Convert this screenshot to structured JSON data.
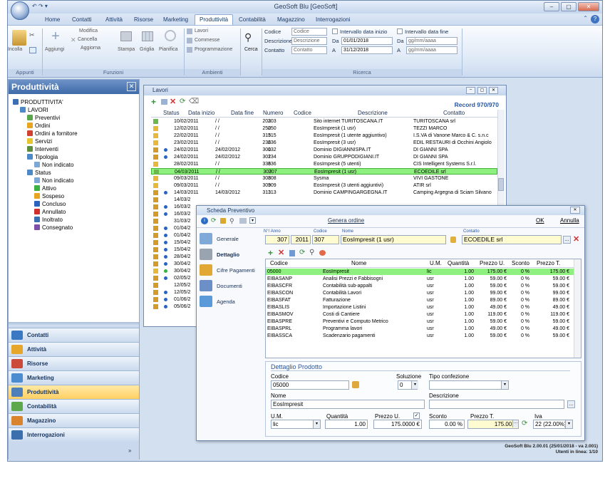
{
  "app": {
    "title": "GeoSoft Blu [GeoSoft]",
    "version_line1": "GeoSoft Blu 2.00.01 (25/01/2018 - va 2.001)",
    "version_line2": "Utenti in linea: 1/10"
  },
  "ribbon_tabs": [
    "Home",
    "Contatti",
    "Attività",
    "Risorse",
    "Marketing",
    "Produttività",
    "Contabilità",
    "Magazzino",
    "Interrogazioni"
  ],
  "ribbon": {
    "appunti": {
      "label": "Appunti",
      "incolla": "Incolla"
    },
    "funzioni": {
      "label": "Funzioni",
      "aggiungi": "Aggiungi",
      "modifica": "Modifica",
      "cancella": "Cancella",
      "aggiorna": "Aggiorna",
      "stampa": "Stampa",
      "griglia": "Griglia",
      "pianifica": "Pianifica"
    },
    "ambienti": {
      "label": "Ambienti",
      "lavori": "Lavori",
      "commesse": "Commesse",
      "programmazione": "Programmazione"
    },
    "cerca": "Cerca",
    "ricerca": {
      "label": "Ricerca",
      "codice_label": "Codice",
      "codice_ph": "Codice",
      "descrizione_label": "Descrizione",
      "descrizione_ph": "Descrizione",
      "contatto_label": "Contatto",
      "contatto_ph": "Contatto",
      "intervallo_inizio": "Intervallo data inizio",
      "intervallo_fine": "Intervallo data fine",
      "da": "Da",
      "a": "A",
      "da_inizio": "01/01/2018",
      "a_inizio": "31/12/2018",
      "da_fine": "gg/mm/aaaa",
      "a_fine": "gg/mm/aaaa"
    }
  },
  "left_panel": {
    "title": "Produttività",
    "tree": [
      {
        "label": "PRODUTTIVITA'",
        "level": 0,
        "color": "#3b6fb3"
      },
      {
        "label": "LAVORI",
        "level": 1,
        "color": "#4d88c9"
      },
      {
        "label": "Preventivi",
        "level": 2,
        "color": "#58a84b"
      },
      {
        "label": "Ordini",
        "level": 2,
        "color": "#e7a521"
      },
      {
        "label": "Ordini a fornitore",
        "level": 2,
        "color": "#d0412f"
      },
      {
        "label": "Servizi",
        "level": 2,
        "color": "#e7c531"
      },
      {
        "label": "Interventi",
        "level": 2,
        "color": "#5b8f3d"
      },
      {
        "label": "Tipologia",
        "level": 2,
        "color": "#4d88c9"
      },
      {
        "label": "Non indicato",
        "level": 3,
        "color": "#7fa7d6"
      },
      {
        "label": "Status",
        "level": 2,
        "color": "#4d88c9"
      },
      {
        "label": "Non indicato",
        "level": 3,
        "color": "#7fa7d6"
      },
      {
        "label": "Attivo",
        "level": 3,
        "color": "#3cb043"
      },
      {
        "label": "Sospeso",
        "level": 3,
        "color": "#e7a521"
      },
      {
        "label": "Concluso",
        "level": 3,
        "color": "#2c63c1"
      },
      {
        "label": "Annullato",
        "level": 3,
        "color": "#d0312f"
      },
      {
        "label": "Inoltrato",
        "level": 3,
        "color": "#3b6fb3"
      },
      {
        "label": "Consegnato",
        "level": 3,
        "color": "#7d4fa8"
      }
    ],
    "nav": [
      {
        "label": "Contatti",
        "color": "#3b78c4"
      },
      {
        "label": "Attività",
        "color": "#e6a52b"
      },
      {
        "label": "Risorse",
        "color": "#cc4a3a"
      },
      {
        "label": "Marketing",
        "color": "#4b8bd0"
      },
      {
        "label": "Produttività",
        "color": "#4f7fb8"
      },
      {
        "label": "Contabilità",
        "color": "#5da84a"
      },
      {
        "label": "Magazzino",
        "color": "#d9842c"
      },
      {
        "label": "Interrogazioni",
        "color": "#3c6fae"
      }
    ],
    "active_nav": "Produttività"
  },
  "lavori": {
    "title": "Lavori",
    "record": "Record 970/970",
    "columns": [
      "Status",
      "Data inizio",
      "Data fine",
      "Numero",
      "Codice",
      "Descrizione",
      "Contatto"
    ],
    "rows": [
      {
        "dot": "",
        "date": "10/02/2011",
        "end": "/ /",
        "num": "203",
        "cod": "203",
        "desc": "Sito internet TURITOSCANA.IT",
        "cont": "TURITOSCANA srl",
        "st": "g"
      },
      {
        "dot": "",
        "date": "12/02/2011",
        "end": "/ /",
        "num": "250",
        "cod": "250",
        "desc": "EosImpresit (1 usr)",
        "cont": "TEZZI MARCO",
        "st": "y"
      },
      {
        "dot": "",
        "date": "22/02/2011",
        "end": "/ /",
        "num": "315",
        "cod": "315",
        "desc": "EosImpresit (1 utente aggiuntivo)",
        "cont": "I.S.VA di Vanone Marco & C. s.n.c",
        "st": "y"
      },
      {
        "dot": "",
        "date": "23/02/2011",
        "end": "/ /",
        "num": "236",
        "cod": "236",
        "desc": "EosImpresit (3 usr)",
        "cont": "EDIL RESTAURI di Occhini Angiolo",
        "st": "y"
      },
      {
        "dot": "b",
        "date": "24/02/2011",
        "end": "24/02/2012",
        "num": "300",
        "cod": "132",
        "desc": "Dominio DIGIANNISPA.IT",
        "cont": "DI GIANNI SPA",
        "st": "o"
      },
      {
        "dot": "b",
        "date": "24/02/2011",
        "end": "24/02/2012",
        "num": "302",
        "cod": "134",
        "desc": "Dominio GRUPPODIGIANI.IT",
        "cont": "DI GIANNI SPA",
        "st": "o"
      },
      {
        "dot": "",
        "date": "28/02/2011",
        "end": "/ /",
        "num": "336",
        "cod": "336",
        "desc": "EosImpresit (5 utenti)",
        "cont": "CIS Intelligent Systems S.r.l.",
        "st": "y"
      },
      {
        "dot": "",
        "date": "04/03/2011",
        "end": "/ /",
        "num": "307",
        "cod": "307",
        "desc": "EosImpresit (1 usr)",
        "cont": "ECOEDILE srl",
        "st": "g",
        "sel": true
      },
      {
        "dot": "",
        "date": "09/03/2011",
        "end": "/ /",
        "num": "308",
        "cod": "308",
        "desc": "Sysma",
        "cont": "VIVI GASTONE",
        "st": "y"
      },
      {
        "dot": "",
        "date": "09/03/2011",
        "end": "/ /",
        "num": "309",
        "cod": "309",
        "desc": "EosImpresit (3 utenti aggiuntivi)",
        "cont": "ATIR srl",
        "st": "y"
      },
      {
        "dot": "b",
        "date": "14/03/2011",
        "end": "14/03/2012",
        "num": "313",
        "cod": "313",
        "desc": "Dominio CAMPINGARGEGNA.IT",
        "cont": "Camping Argegna di Sciam Silvano",
        "st": "o"
      },
      {
        "dot": "",
        "date": "14/03/2",
        "end": "",
        "num": "",
        "cod": "",
        "desc": "",
        "cont": "",
        "st": "o"
      },
      {
        "dot": "b",
        "date": "16/03/2",
        "end": "",
        "num": "",
        "cod": "",
        "desc": "",
        "cont": "",
        "st": "o"
      },
      {
        "dot": "b",
        "date": "16/03/2",
        "end": "",
        "num": "",
        "cod": "",
        "desc": "",
        "cont": "",
        "st": "o"
      },
      {
        "dot": "",
        "date": "31/03/2",
        "end": "",
        "num": "",
        "cod": "",
        "desc": "",
        "cont": "",
        "st": "o"
      },
      {
        "dot": "b",
        "date": "01/04/2",
        "end": "",
        "num": "",
        "cod": "",
        "desc": "",
        "cont": "",
        "st": "o"
      },
      {
        "dot": "b",
        "date": "01/04/2",
        "end": "",
        "num": "",
        "cod": "",
        "desc": "",
        "cont": "",
        "st": "o"
      },
      {
        "dot": "b",
        "date": "15/04/2",
        "end": "",
        "num": "",
        "cod": "",
        "desc": "",
        "cont": "",
        "st": "o"
      },
      {
        "dot": "b",
        "date": "15/04/2",
        "end": "",
        "num": "",
        "cod": "",
        "desc": "",
        "cont": "",
        "st": "o"
      },
      {
        "dot": "b",
        "date": "28/04/2",
        "end": "",
        "num": "",
        "cod": "",
        "desc": "",
        "cont": "",
        "st": "o"
      },
      {
        "dot": "b",
        "date": "30/04/2",
        "end": "",
        "num": "",
        "cod": "",
        "desc": "",
        "cont": "",
        "st": "o"
      },
      {
        "dot": "g",
        "date": "30/04/2",
        "end": "",
        "num": "",
        "cod": "",
        "desc": "",
        "cont": "",
        "st": "y"
      },
      {
        "dot": "b",
        "date": "02/05/2",
        "end": "",
        "num": "",
        "cod": "",
        "desc": "",
        "cont": "",
        "st": "o"
      },
      {
        "dot": "",
        "date": "12/05/2",
        "end": "",
        "num": "",
        "cod": "",
        "desc": "",
        "cont": "",
        "st": "o"
      },
      {
        "dot": "b",
        "date": "12/05/2",
        "end": "",
        "num": "",
        "cod": "",
        "desc": "",
        "cont": "",
        "st": "o"
      },
      {
        "dot": "b",
        "date": "01/06/2",
        "end": "",
        "num": "",
        "cod": "",
        "desc": "",
        "cont": "",
        "st": "o"
      },
      {
        "dot": "b",
        "date": "05/06/2",
        "end": "",
        "num": "",
        "cod": "",
        "desc": "",
        "cont": "",
        "st": "o"
      }
    ]
  },
  "scheda": {
    "title": "Scheda Preventivo",
    "genera": "Genera ordine",
    "ok": "OK",
    "annulla": "Annulla",
    "nav": [
      "Generale",
      "Dettaglio",
      "Cifre Pagamenti",
      "Documenti",
      "Agenda"
    ],
    "active_nav": "Dettaglio",
    "hdr_labels": {
      "anno": "N°/ Anno",
      "codice": "Codice",
      "nome": "Nome",
      "contatto": "Contatto"
    },
    "hdr_values": {
      "num": "307",
      "anno": "2011",
      "codice": "307",
      "nome": "EosImpresit (1 usr)",
      "contatto": "ECOEDILE srl"
    },
    "grid_columns": [
      "Codice",
      "Nome",
      "U.M.",
      "Quantità",
      "Prezzo U.",
      "Sconto",
      "Prezzo T."
    ],
    "grid_rows": [
      {
        "cod": "05000",
        "nome": "EosImpresit",
        "um": "lic",
        "q": "1.00",
        "pu": "175.00 €",
        "sc": "0 %",
        "pt": "175.00 €",
        "sel": true
      },
      {
        "cod": "EIBASANP",
        "nome": "Analisi Prezzi e Fabbisogni",
        "um": "usr",
        "q": "1.00",
        "pu": "59.00 €",
        "sc": "0 %",
        "pt": "59.00 €"
      },
      {
        "cod": "EIBASCFR",
        "nome": "Contabilità sub-appalti",
        "um": "usr",
        "q": "1.00",
        "pu": "59.00 €",
        "sc": "0 %",
        "pt": "59.00 €"
      },
      {
        "cod": "EIBASCON",
        "nome": "Contabilità Lavori",
        "um": "usr",
        "q": "1.00",
        "pu": "99.00 €",
        "sc": "0 %",
        "pt": "99.00 €"
      },
      {
        "cod": "EIBASFAT",
        "nome": "Fatturazione",
        "um": "usr",
        "q": "1.00",
        "pu": "89.00 €",
        "sc": "0 %",
        "pt": "89.00 €"
      },
      {
        "cod": "EIBASLIS",
        "nome": "Importazione Listini",
        "um": "usr",
        "q": "1.00",
        "pu": "49.00 €",
        "sc": "0 %",
        "pt": "49.00 €"
      },
      {
        "cod": "EIBASMOV",
        "nome": "Costi di Cantiere",
        "um": "usr",
        "q": "1.00",
        "pu": "119.00 €",
        "sc": "0 %",
        "pt": "119.00 €"
      },
      {
        "cod": "EIBASPRE",
        "nome": "Preventivi e Computo Metrico",
        "um": "usr",
        "q": "1.00",
        "pu": "59.00 €",
        "sc": "0 %",
        "pt": "59.00 €"
      },
      {
        "cod": "EIBASPRL",
        "nome": "Programma lavori",
        "um": "usr",
        "q": "1.00",
        "pu": "49.00 €",
        "sc": "0 %",
        "pt": "49.00 €"
      },
      {
        "cod": "EIBASSCA",
        "nome": "Scadenzario pagamenti",
        "um": "usr",
        "q": "1.00",
        "pu": "59.00 €",
        "sc": "0 %",
        "pt": "59.00 €"
      }
    ],
    "detail": {
      "title": "Dettaglio Prodotto",
      "codice_label": "Codice",
      "codice": "05000",
      "soluzione_label": "Soluzione",
      "soluzione": "0",
      "tipo_label": "Tipo confezione",
      "tipo": "",
      "nome_label": "Nome",
      "nome": "EosImpresit",
      "descrizione_label": "Descrizione",
      "descrizione": "",
      "um_label": "U.M.",
      "um": "lic",
      "quantita_label": "Quantità",
      "quantita": "1.00",
      "prezzou_label": "Prezzo U.",
      "prezzou": "175.0000 €",
      "sconto_label": "Sconto",
      "sconto": "0.00 %",
      "prezzot_label": "Prezzo T.",
      "prezzot": "175.00 €",
      "iva_label": "Iva",
      "iva": "22 (22.00%)"
    }
  }
}
